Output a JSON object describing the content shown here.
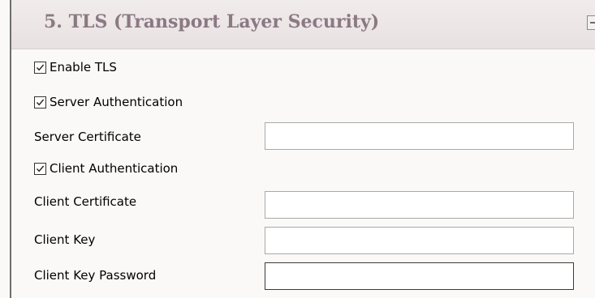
{
  "section": {
    "title": "5. TLS (Transport Layer Security)",
    "collapse_icon": "collapse-minus-icon"
  },
  "enable_tls": {
    "label": "Enable TLS",
    "checked": true
  },
  "server_authentication": {
    "label": "Server Authentication",
    "checked": true
  },
  "server_certificate": {
    "label": "Server Certificate",
    "value": ""
  },
  "client_authentication": {
    "label": "Client Authentication",
    "checked": true
  },
  "client_certificate": {
    "label": "Client Certificate",
    "value": ""
  },
  "client_key": {
    "label": "Client Key",
    "value": ""
  },
  "client_key_password": {
    "label": "Client Key Password",
    "value": ""
  },
  "colors": {
    "header_text": "#8b7983",
    "panel_background": "#fbf9f7",
    "left_border": "#6e6e70"
  }
}
